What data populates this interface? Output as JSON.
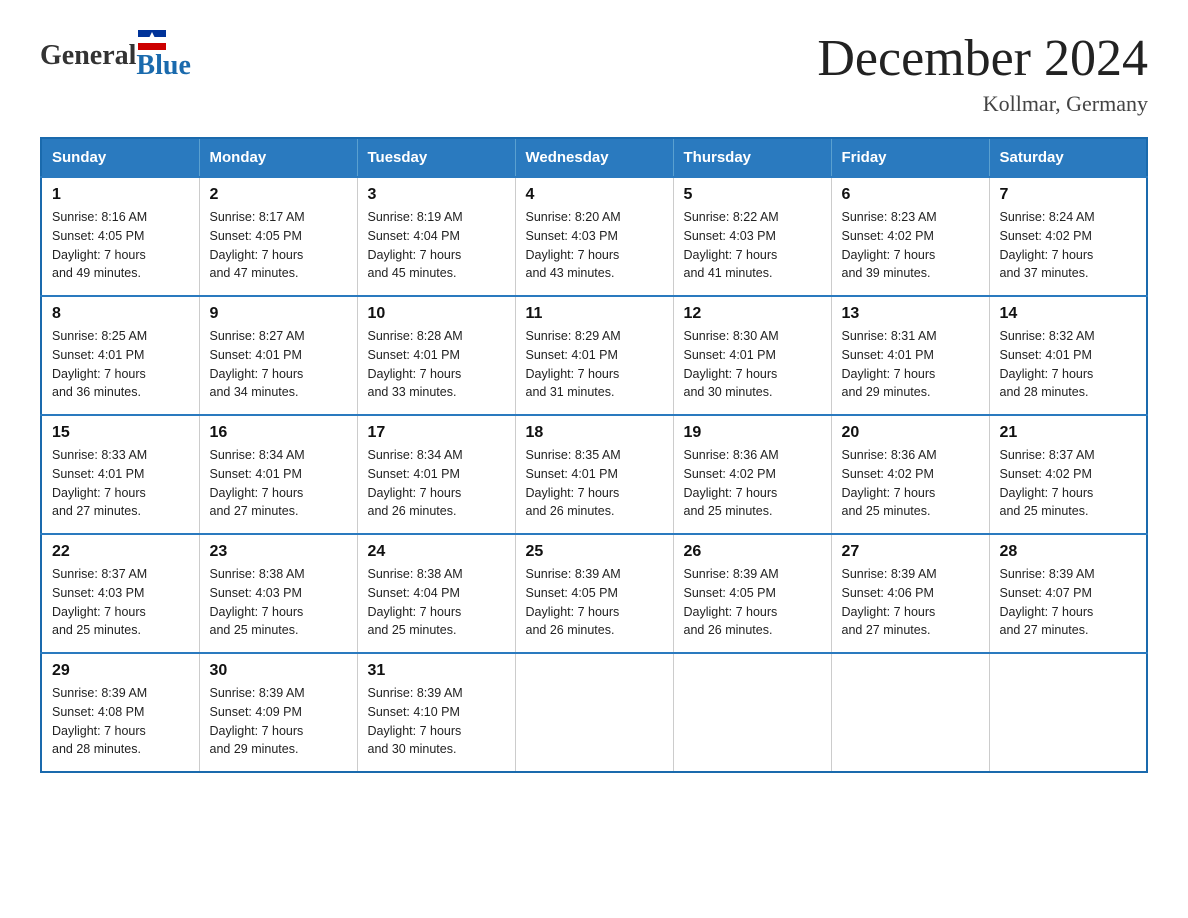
{
  "logo": {
    "general": "General",
    "blue": "Blue"
  },
  "title": "December 2024",
  "subtitle": "Kollmar, Germany",
  "header": {
    "days": [
      "Sunday",
      "Monday",
      "Tuesday",
      "Wednesday",
      "Thursday",
      "Friday",
      "Saturday"
    ]
  },
  "weeks": [
    [
      {
        "day": "1",
        "sunrise": "8:16 AM",
        "sunset": "4:05 PM",
        "daylight": "7 hours and 49 minutes."
      },
      {
        "day": "2",
        "sunrise": "8:17 AM",
        "sunset": "4:05 PM",
        "daylight": "7 hours and 47 minutes."
      },
      {
        "day": "3",
        "sunrise": "8:19 AM",
        "sunset": "4:04 PM",
        "daylight": "7 hours and 45 minutes."
      },
      {
        "day": "4",
        "sunrise": "8:20 AM",
        "sunset": "4:03 PM",
        "daylight": "7 hours and 43 minutes."
      },
      {
        "day": "5",
        "sunrise": "8:22 AM",
        "sunset": "4:03 PM",
        "daylight": "7 hours and 41 minutes."
      },
      {
        "day": "6",
        "sunrise": "8:23 AM",
        "sunset": "4:02 PM",
        "daylight": "7 hours and 39 minutes."
      },
      {
        "day": "7",
        "sunrise": "8:24 AM",
        "sunset": "4:02 PM",
        "daylight": "7 hours and 37 minutes."
      }
    ],
    [
      {
        "day": "8",
        "sunrise": "8:25 AM",
        "sunset": "4:01 PM",
        "daylight": "7 hours and 36 minutes."
      },
      {
        "day": "9",
        "sunrise": "8:27 AM",
        "sunset": "4:01 PM",
        "daylight": "7 hours and 34 minutes."
      },
      {
        "day": "10",
        "sunrise": "8:28 AM",
        "sunset": "4:01 PM",
        "daylight": "7 hours and 33 minutes."
      },
      {
        "day": "11",
        "sunrise": "8:29 AM",
        "sunset": "4:01 PM",
        "daylight": "7 hours and 31 minutes."
      },
      {
        "day": "12",
        "sunrise": "8:30 AM",
        "sunset": "4:01 PM",
        "daylight": "7 hours and 30 minutes."
      },
      {
        "day": "13",
        "sunrise": "8:31 AM",
        "sunset": "4:01 PM",
        "daylight": "7 hours and 29 minutes."
      },
      {
        "day": "14",
        "sunrise": "8:32 AM",
        "sunset": "4:01 PM",
        "daylight": "7 hours and 28 minutes."
      }
    ],
    [
      {
        "day": "15",
        "sunrise": "8:33 AM",
        "sunset": "4:01 PM",
        "daylight": "7 hours and 27 minutes."
      },
      {
        "day": "16",
        "sunrise": "8:34 AM",
        "sunset": "4:01 PM",
        "daylight": "7 hours and 27 minutes."
      },
      {
        "day": "17",
        "sunrise": "8:34 AM",
        "sunset": "4:01 PM",
        "daylight": "7 hours and 26 minutes."
      },
      {
        "day": "18",
        "sunrise": "8:35 AM",
        "sunset": "4:01 PM",
        "daylight": "7 hours and 26 minutes."
      },
      {
        "day": "19",
        "sunrise": "8:36 AM",
        "sunset": "4:02 PM",
        "daylight": "7 hours and 25 minutes."
      },
      {
        "day": "20",
        "sunrise": "8:36 AM",
        "sunset": "4:02 PM",
        "daylight": "7 hours and 25 minutes."
      },
      {
        "day": "21",
        "sunrise": "8:37 AM",
        "sunset": "4:02 PM",
        "daylight": "7 hours and 25 minutes."
      }
    ],
    [
      {
        "day": "22",
        "sunrise": "8:37 AM",
        "sunset": "4:03 PM",
        "daylight": "7 hours and 25 minutes."
      },
      {
        "day": "23",
        "sunrise": "8:38 AM",
        "sunset": "4:03 PM",
        "daylight": "7 hours and 25 minutes."
      },
      {
        "day": "24",
        "sunrise": "8:38 AM",
        "sunset": "4:04 PM",
        "daylight": "7 hours and 25 minutes."
      },
      {
        "day": "25",
        "sunrise": "8:39 AM",
        "sunset": "4:05 PM",
        "daylight": "7 hours and 26 minutes."
      },
      {
        "day": "26",
        "sunrise": "8:39 AM",
        "sunset": "4:05 PM",
        "daylight": "7 hours and 26 minutes."
      },
      {
        "day": "27",
        "sunrise": "8:39 AM",
        "sunset": "4:06 PM",
        "daylight": "7 hours and 27 minutes."
      },
      {
        "day": "28",
        "sunrise": "8:39 AM",
        "sunset": "4:07 PM",
        "daylight": "7 hours and 27 minutes."
      }
    ],
    [
      {
        "day": "29",
        "sunrise": "8:39 AM",
        "sunset": "4:08 PM",
        "daylight": "7 hours and 28 minutes."
      },
      {
        "day": "30",
        "sunrise": "8:39 AM",
        "sunset": "4:09 PM",
        "daylight": "7 hours and 29 minutes."
      },
      {
        "day": "31",
        "sunrise": "8:39 AM",
        "sunset": "4:10 PM",
        "daylight": "7 hours and 30 minutes."
      },
      null,
      null,
      null,
      null
    ]
  ],
  "labels": {
    "sunrise": "Sunrise:",
    "sunset": "Sunset:",
    "daylight": "Daylight:"
  }
}
